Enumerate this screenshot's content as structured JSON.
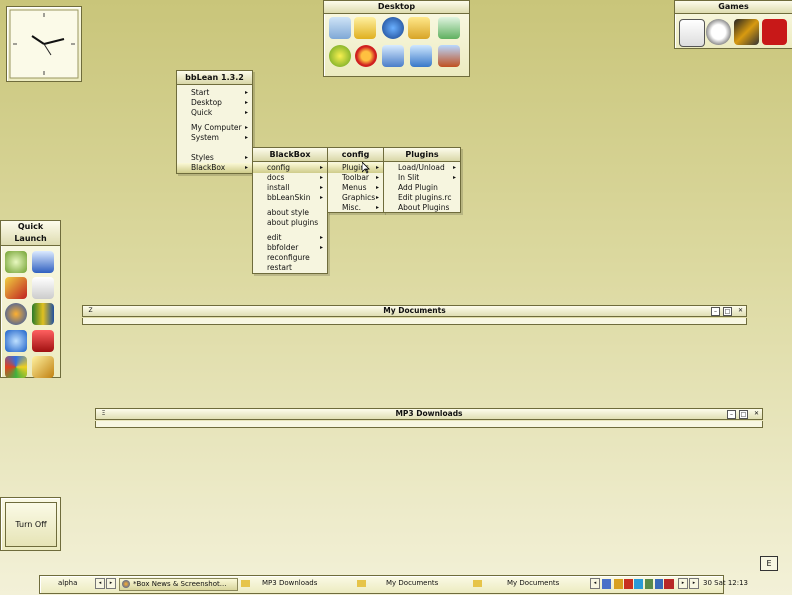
{
  "desktop_panel": {
    "title": "Desktop"
  },
  "games_panel": {
    "title": "Games"
  },
  "quick_launch": {
    "title": "Quick Launch"
  },
  "turn_off": {
    "label": "Turn Off"
  },
  "bbmenu": {
    "title": "bbLean 1.3.2",
    "items": [
      "Start",
      "Desktop",
      "Quick",
      "My Computer",
      "System",
      "Styles",
      "BlackBox"
    ]
  },
  "blackbox_menu": {
    "title": "BlackBox",
    "items": [
      "config",
      "docs",
      "install",
      "bbLeanSkin",
      "about style",
      "about plugins",
      "edit",
      "bbfolder",
      "reconfigure",
      "restart"
    ]
  },
  "config_menu": {
    "title": "config",
    "items": [
      "Plugins",
      "Toolbar",
      "Menus",
      "Graphics",
      "Misc."
    ]
  },
  "plugins_menu": {
    "title": "Plugins",
    "items": [
      "Load/Unload",
      "In Slit",
      "Add Plugin",
      "Edit plugins.rc",
      "About Plugins"
    ]
  },
  "window_mydocs": {
    "title": "My Documents",
    "left_btn": "Z"
  },
  "window_mp3": {
    "title": "MP3 Downloads",
    "left_btn": "Ξ"
  },
  "corner_btn": {
    "label": "E"
  },
  "taskbar": {
    "workspace": "alpha",
    "tasks": [
      "*Box News & Screenshot...",
      "MP3 Downloads",
      "My Documents",
      "My Documents"
    ],
    "clock": "30 Sat 12:13"
  }
}
